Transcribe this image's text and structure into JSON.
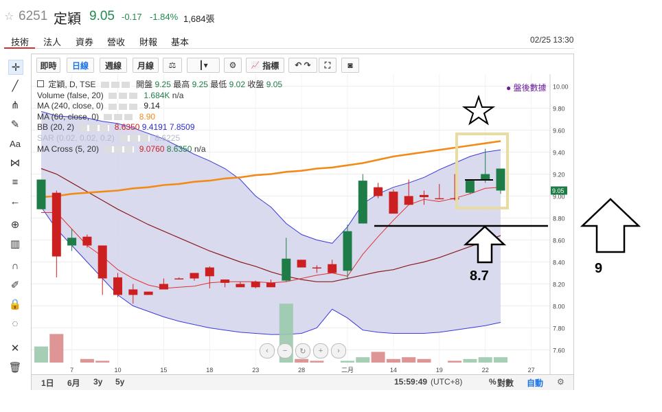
{
  "header": {
    "star_icon": "star-outline-icon",
    "stock_code": "6251",
    "stock_name": "定穎",
    "price": "9.05",
    "change": "-0.17",
    "change_pct": "-1.84%",
    "volume": "1,684張",
    "datetime": "02/25 13:30"
  },
  "tabs": [
    "技術",
    "法人",
    "資券",
    "營收",
    "財報",
    "基本"
  ],
  "active_tab": "技術",
  "toolbar": {
    "intraday": "即時",
    "daily": "日線",
    "weekly": "週線",
    "monthly": "月線",
    "indicators": "指標"
  },
  "left_tools": [
    "crosshair-icon",
    "line-tool-icon",
    "pitchfork-icon",
    "brush-icon",
    "text-tool-icon",
    "pattern-icon",
    "fib-icon",
    "arrow-left-icon",
    "zoom-icon",
    "measure-icon",
    "magnet-icon",
    "eraser-icon",
    "lock-icon",
    "eye-icon",
    "settings-icon",
    "trash-icon"
  ],
  "legend": {
    "main": "定穎, D, TSE",
    "open_label": "開盤",
    "open": "9.25",
    "high_label": "最高",
    "high": "9.25",
    "low_label": "最低",
    "low": "9.02",
    "close_label": "收盤",
    "close": "9.05",
    "volume_name": "Volume (false, 20)",
    "volume_value": "1.684K",
    "volume_na": "n/a",
    "ma240_name": "MA (240, close, 0)",
    "ma240_value": "9.14",
    "ma60_name": "MA (60, close, 0)",
    "ma60_value": "8.90",
    "bb_name": "BB (20, 2)",
    "bb_mid": "8.6350",
    "bb_upper": "9.4191",
    "bb_lower": "7.8509",
    "sar_name": "SAR (0.02, 0.02, 0.2)",
    "sar_value": "8.6225",
    "cross_name": "MA Cross (5, 20)",
    "cross_fast": "9.0760",
    "cross_slow": "8.6350",
    "cross_na": "n/a"
  },
  "post_market": "● 盤後數據",
  "bottom_bar": {
    "ranges": [
      "1日",
      "6月",
      "3y",
      "5y"
    ],
    "time": "15:59:49",
    "tz": "(UTC+8)",
    "percent": "%",
    "log": "對數",
    "auto": "自動"
  },
  "annotations": {
    "nine": "9",
    "eight_seven": "8.7"
  },
  "colors": {
    "up": "#cc1f1f",
    "down": "#1e7d46",
    "bb_fill": "#d4d4ec",
    "bb_line": "#3a3ad6",
    "ma60": "#f28a18",
    "ma240": "#8b1a1a",
    "cross_fast": "#e03030",
    "box": "#e8dca0"
  },
  "chart_data": {
    "type": "candlestick",
    "price_axis": {
      "min": 7.5,
      "max": 10.0,
      "ticks": [
        "10.00",
        "9.80",
        "9.60",
        "9.40",
        "9.20",
        "9.00",
        "8.80",
        "8.60",
        "8.40",
        "8.20",
        "8.00",
        "7.80",
        "7.60"
      ],
      "last_price_label": "9.05"
    },
    "x_tick_labels": [
      {
        "index": 2,
        "label": "7"
      },
      {
        "index": 5,
        "label": "10"
      },
      {
        "index": 8,
        "label": "15"
      },
      {
        "index": 11,
        "label": "18"
      },
      {
        "index": 14,
        "label": "23"
      },
      {
        "index": 17,
        "label": "28"
      },
      {
        "index": 20,
        "label": "二月"
      },
      {
        "index": 23,
        "label": "14"
      },
      {
        "index": 26,
        "label": "19"
      },
      {
        "index": 29,
        "label": "22"
      },
      {
        "index": 32,
        "label": "27"
      }
    ],
    "candles": [
      {
        "o": 9.15,
        "h": 9.15,
        "l": 8.88,
        "c": 8.88
      },
      {
        "o": 8.45,
        "h": 9.05,
        "l": 8.26,
        "c": 9.03
      },
      {
        "o": 8.62,
        "h": 8.7,
        "l": 8.5,
        "c": 8.55
      },
      {
        "o": 8.55,
        "h": 8.65,
        "l": 8.53,
        "c": 8.63
      },
      {
        "o": 8.25,
        "h": 8.55,
        "l": 8.1,
        "c": 8.55
      },
      {
        "o": 8.1,
        "h": 8.3,
        "l": 8.08,
        "c": 8.26
      },
      {
        "o": 8.1,
        "h": 8.2,
        "l": 8.02,
        "c": 8.15
      },
      {
        "o": 8.1,
        "h": 8.13,
        "l": 8.1,
        "c": 8.13
      },
      {
        "o": 8.15,
        "h": 8.25,
        "l": 8.15,
        "c": 8.2
      },
      {
        "o": 8.25,
        "h": 8.26,
        "l": 8.24,
        "c": 8.25
      },
      {
        "o": 8.25,
        "h": 8.3,
        "l": 8.23,
        "c": 8.3
      },
      {
        "o": 8.27,
        "h": 8.36,
        "l": 8.16,
        "c": 8.35
      },
      {
        "o": 8.21,
        "h": 8.24,
        "l": 8.17,
        "c": 8.24
      },
      {
        "o": 8.17,
        "h": 8.22,
        "l": 8.17,
        "c": 8.2
      },
      {
        "o": 8.17,
        "h": 8.23,
        "l": 8.16,
        "c": 8.22
      },
      {
        "o": 8.17,
        "h": 8.24,
        "l": 8.17,
        "c": 8.21
      },
      {
        "o": 8.43,
        "h": 8.62,
        "l": 8.22,
        "c": 8.23
      },
      {
        "o": 8.35,
        "h": 8.42,
        "l": 8.36,
        "c": 8.42
      },
      {
        "o": 8.35,
        "h": 8.37,
        "l": 8.3,
        "c": 8.35
      },
      {
        "o": 8.3,
        "h": 8.42,
        "l": 8.3,
        "c": 8.38
      },
      {
        "o": 8.68,
        "h": 8.74,
        "l": 8.24,
        "c": 8.32
      },
      {
        "o": 9.14,
        "h": 9.2,
        "l": 8.75,
        "c": 8.75
      },
      {
        "o": 9.0,
        "h": 9.12,
        "l": 8.98,
        "c": 9.08
      },
      {
        "o": 8.84,
        "h": 9.06,
        "l": 8.84,
        "c": 9.04
      },
      {
        "o": 8.92,
        "h": 9.15,
        "l": 8.92,
        "c": 9.0
      },
      {
        "o": 8.99,
        "h": 9.05,
        "l": 8.92,
        "c": 9.01
      },
      {
        "o": 8.98,
        "h": 9.11,
        "l": 8.98,
        "c": 8.98
      },
      {
        "o": 8.98,
        "h": 9.2,
        "l": 8.96,
        "c": 8.98
      },
      {
        "o": 9.14,
        "h": 9.15,
        "l": 9.02,
        "c": 9.03
      },
      {
        "o": 9.2,
        "h": 9.43,
        "l": 9.12,
        "c": 9.15
      },
      {
        "o": 9.25,
        "h": 9.25,
        "l": 9.02,
        "c": 9.05
      }
    ],
    "bb_upper": [
      9.77,
      9.73,
      9.72,
      9.71,
      9.68,
      9.66,
      9.62,
      9.57,
      9.52,
      9.45,
      9.38,
      9.32,
      9.25,
      9.15,
      9.0,
      8.9,
      8.75,
      8.65,
      8.6,
      8.57,
      8.72,
      8.93,
      9.02,
      9.08,
      9.12,
      9.17,
      9.24,
      9.3,
      9.36,
      9.4,
      9.42
    ],
    "bb_lower": [
      8.9,
      8.7,
      8.55,
      8.4,
      8.25,
      8.1,
      8.0,
      7.95,
      7.9,
      7.86,
      7.83,
      7.8,
      7.78,
      7.76,
      7.75,
      7.74,
      7.74,
      7.75,
      7.8,
      7.97,
      7.89,
      7.78,
      7.76,
      7.75,
      7.75,
      7.75,
      7.76,
      7.78,
      7.8,
      7.82,
      7.85
    ],
    "bb_middle": [
      9.25,
      9.2,
      9.12,
      9.04,
      8.96,
      8.88,
      8.81,
      8.74,
      8.68,
      8.62,
      8.56,
      8.5,
      8.45,
      8.4,
      8.36,
      8.31,
      8.27,
      8.24,
      8.22,
      8.22,
      8.25,
      8.28,
      8.31,
      8.33,
      8.37,
      8.4,
      8.44,
      8.49,
      8.54,
      8.59,
      8.64
    ],
    "ma60": [
      8.99,
      9.0,
      9.02,
      9.03,
      9.04,
      9.05,
      9.07,
      9.08,
      9.1,
      9.11,
      9.13,
      9.14,
      9.16,
      9.17,
      9.19,
      9.2,
      9.22,
      9.23,
      9.25,
      9.26,
      9.28,
      9.3,
      9.33,
      9.36,
      9.38,
      9.4,
      9.42,
      9.44,
      9.46,
      9.48,
      9.5
    ],
    "ma_cross_fast": [
      8.85,
      8.85,
      8.7,
      8.55,
      8.45,
      8.33,
      8.25,
      8.19,
      8.16,
      8.17,
      8.18,
      8.21,
      8.22,
      8.22,
      8.22,
      8.21,
      8.22,
      8.25,
      8.28,
      8.3,
      8.27,
      8.47,
      8.63,
      8.78,
      8.92,
      8.97,
      8.95,
      8.98,
      9.02,
      9.07,
      9.08
    ],
    "volume": [
      0.9,
      1.6,
      0,
      0.2,
      0.1,
      0,
      0,
      0,
      0,
      0,
      0,
      0,
      0,
      0,
      0,
      0,
      3.3,
      0.2,
      0.1,
      0,
      0.1,
      0.3,
      0.6,
      0.2,
      0.3,
      0.2,
      0,
      0.1,
      0.2,
      0.3,
      0.3
    ]
  }
}
